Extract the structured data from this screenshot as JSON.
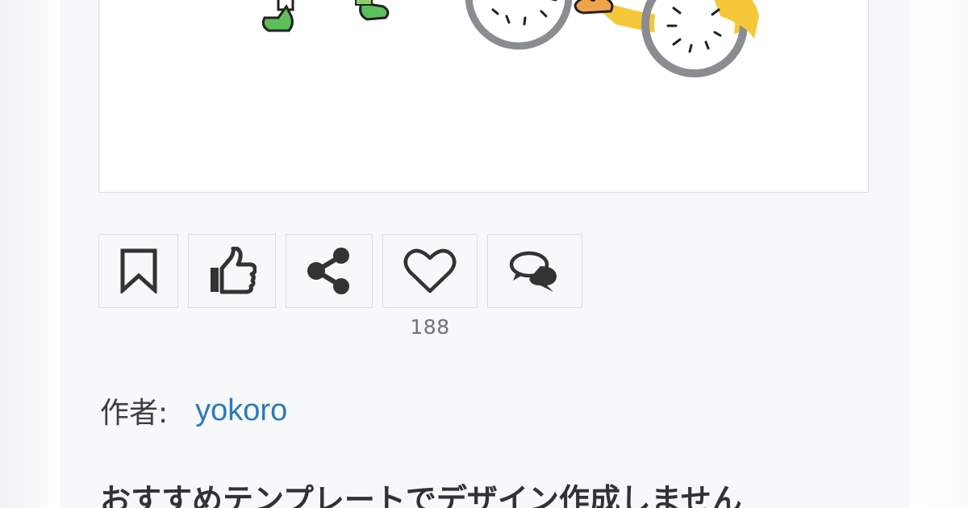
{
  "actions": {
    "bookmark_icon": "bookmark-icon",
    "like_icon": "thumbs-up-icon",
    "share_icon": "share-icon",
    "heart_icon": "heart-icon",
    "heart_count": "188",
    "comment_icon": "comment-icon"
  },
  "author": {
    "label": "作者:",
    "name": "yokoro"
  },
  "promo": {
    "heading": "おすすめテンプレートでデザイン作成しません"
  },
  "colors": {
    "link": "#2b7ab8",
    "bicycle_yellow": "#f5c83a",
    "wheel_gray": "#8a8d90",
    "shoe_green": "#5bbf5a",
    "icon_dark": "#333333"
  }
}
